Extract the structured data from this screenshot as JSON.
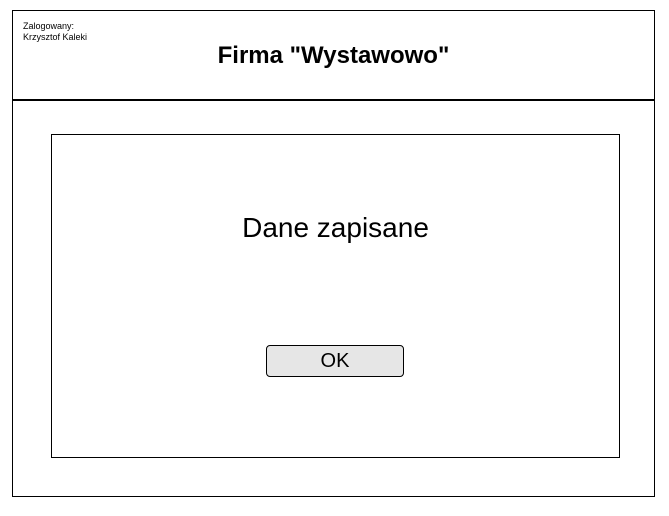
{
  "header": {
    "logged_in_label": "Zalogowany:",
    "user_name": "Krzysztof Kaleki",
    "company_title": "Firma \"Wystawowo\""
  },
  "dialog": {
    "message": "Dane zapisane",
    "ok_label": "OK"
  },
  "colors": {
    "border": "#000000",
    "button_background": "#e6e6e6",
    "background": "#ffffff"
  }
}
